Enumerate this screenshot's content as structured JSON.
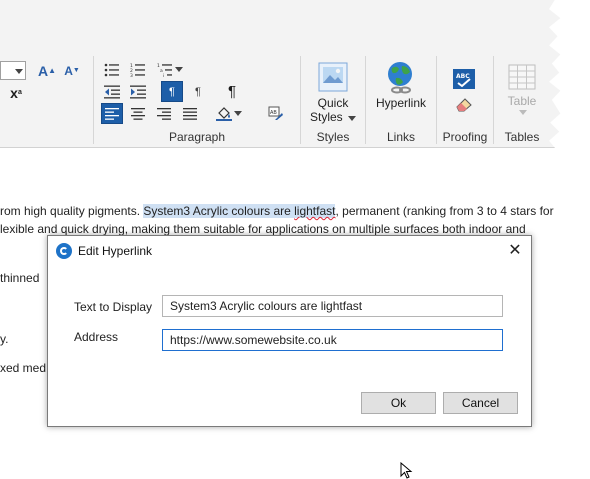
{
  "ribbon": {
    "font_buttons": {
      "grow_font": "A",
      "shrink_font": "A",
      "clear_format": "x"
    },
    "paragraph": {
      "group_label": "Paragraph",
      "show_marks_glyph": "¶",
      "para_ltr_glyph": "¶",
      "para_rtl_glyph": "¶"
    },
    "styles": {
      "quick_styles_label": "Quick\nStyles",
      "quick_styles_line1": "Quick",
      "quick_styles_line2": "Styles",
      "group_label": "Styles"
    },
    "links": {
      "hyperlink_label": "Hyperlink",
      "group_label": "Links"
    },
    "proofing": {
      "group_label": "Proofing",
      "spell_icon_text": "ABC"
    },
    "tables": {
      "table_label": "Table",
      "group_label": "Tables"
    }
  },
  "document": {
    "line1_prefix": "rom high quality pigments. ",
    "line1_selected_a": "System3 Acrylic colours are ",
    "line1_selected_b": "lightfast",
    "line1_suffix": ", permanent (ranking from 3 to 4 stars for",
    "line2": "lexible and quick drying, making them suitable for applications on multiple surfaces both indoor and",
    "line3": " thinned",
    "line4": "y.",
    "line5": "xed med"
  },
  "dialog": {
    "title": "Edit Hyperlink",
    "close_glyph": "✕",
    "text_to_display_label": "Text to Display",
    "text_to_display_value": "System3 Acrylic colours are lightfast",
    "address_label": "Address",
    "address_value": "https://www.somewebsite.co.uk",
    "ok_label": "Ok",
    "cancel_label": "Cancel"
  },
  "colors": {
    "selection_blue": "#1d5ea8",
    "text_highlight": "#cfe0f3",
    "focus_border": "#1f6fd0"
  }
}
